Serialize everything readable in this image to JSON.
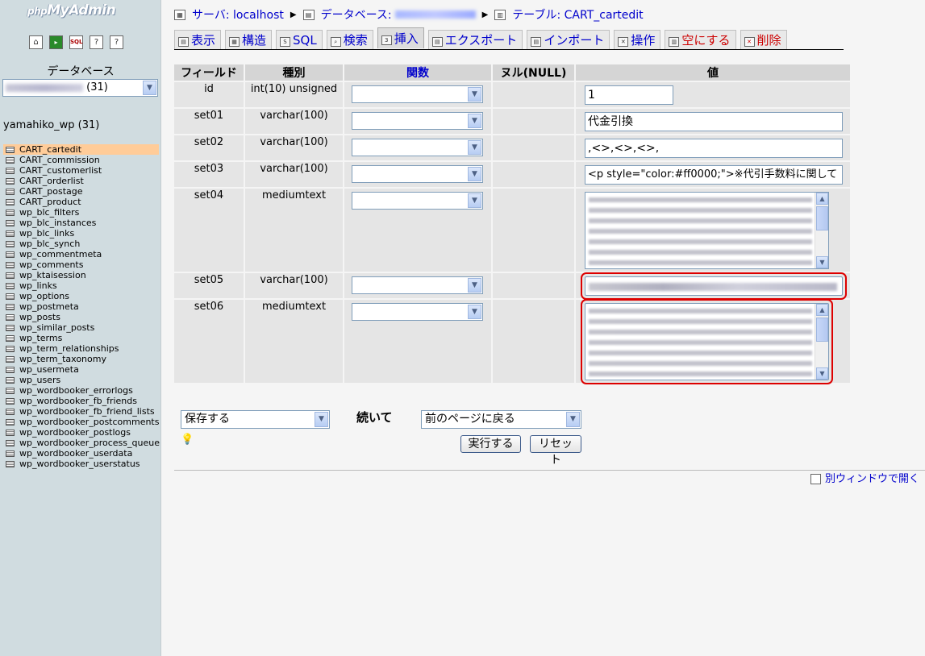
{
  "sidebar": {
    "logo_prefix": "php",
    "logo_main": "MyAdmin",
    "icons": [
      "home-icon",
      "exit-icon",
      "sql-icon",
      "help-icon",
      "docs-icon"
    ],
    "db_label": "データベース",
    "db_select_suffix": "(31)",
    "db_name": "yamahiko_wp (31)",
    "tables": [
      "CART_cartedit",
      "CART_commission",
      "CART_customerlist",
      "CART_orderlist",
      "CART_postage",
      "CART_product",
      "wp_blc_filters",
      "wp_blc_instances",
      "wp_blc_links",
      "wp_blc_synch",
      "wp_commentmeta",
      "wp_comments",
      "wp_ktaisession",
      "wp_links",
      "wp_options",
      "wp_postmeta",
      "wp_posts",
      "wp_similar_posts",
      "wp_terms",
      "wp_term_relationships",
      "wp_term_taxonomy",
      "wp_usermeta",
      "wp_users",
      "wp_wordbooker_errorlogs",
      "wp_wordbooker_fb_friends",
      "wp_wordbooker_fb_friend_lists",
      "wp_wordbooker_postcomments",
      "wp_wordbooker_postlogs",
      "wp_wordbooker_process_queue",
      "wp_wordbooker_userdata",
      "wp_wordbooker_userstatus"
    ]
  },
  "breadcrumb": {
    "server_label": "サーバ: localhost",
    "db_label": "データベース:",
    "table_label": "テーブル: CART_cartedit"
  },
  "tabs": [
    {
      "label": "表示"
    },
    {
      "label": "構造"
    },
    {
      "label": "SQL"
    },
    {
      "label": "検索"
    },
    {
      "label": "挿入"
    },
    {
      "label": "エクスポート"
    },
    {
      "label": "インポート"
    },
    {
      "label": "操作"
    },
    {
      "label": "空にする"
    },
    {
      "label": "削除"
    }
  ],
  "insert_table": {
    "headers": {
      "field": "フィールド",
      "type": "種別",
      "function": "関数",
      "null": "ヌル(NULL)",
      "value": "値"
    },
    "rows": [
      {
        "field": "id",
        "type": "int(10) unsigned",
        "value": "1"
      },
      {
        "field": "set01",
        "type": "varchar(100)",
        "value": "代金引換"
      },
      {
        "field": "set02",
        "type": "varchar(100)",
        "value": ",<>,<>,<>,"
      },
      {
        "field": "set03",
        "type": "varchar(100)",
        "value": "<p style=\"color:#ff0000;\">※代引手数料に関して"
      },
      {
        "field": "set04",
        "type": "mediumtext",
        "value": ""
      },
      {
        "field": "set05",
        "type": "varchar(100)",
        "value": ""
      },
      {
        "field": "set06",
        "type": "mediumtext",
        "value": ""
      }
    ]
  },
  "bottom": {
    "save_option": "保存する",
    "then_label": "続いて",
    "after_option": "前のページに戻る",
    "go_label": "実行する",
    "reset_label": "リセット"
  },
  "footer": {
    "new_window": "別ウィンドウで開く"
  },
  "colors": {
    "link": "#0000cc",
    "active_table": "#ffcc99",
    "highlight": "#dd0000",
    "sidebar_bg": "#d0dce0"
  }
}
